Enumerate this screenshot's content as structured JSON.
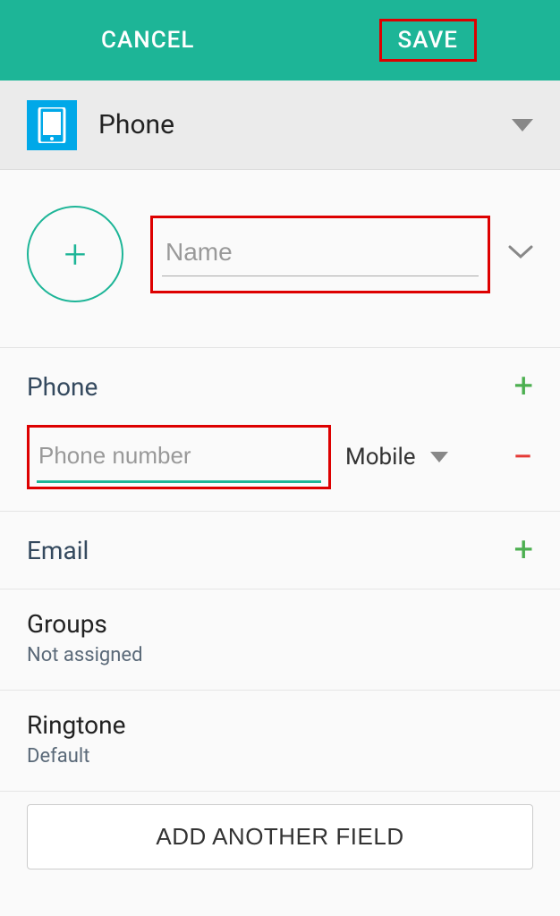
{
  "header": {
    "cancel": "CANCEL",
    "save": "SAVE"
  },
  "account": {
    "label": "Phone"
  },
  "name": {
    "placeholder": "Name"
  },
  "sections": {
    "phone": {
      "title": "Phone",
      "placeholder": "Phone number",
      "type": "Mobile"
    },
    "email": {
      "title": "Email"
    },
    "groups": {
      "title": "Groups",
      "value": "Not assigned"
    },
    "ringtone": {
      "title": "Ringtone",
      "value": "Default"
    }
  },
  "add_field": "ADD ANOTHER FIELD"
}
